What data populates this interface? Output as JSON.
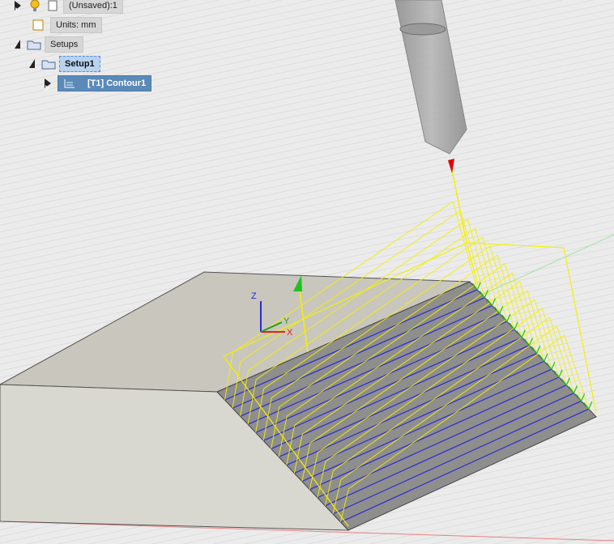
{
  "browser": {
    "document_name": "(Unsaved):1",
    "units_label": "Units: mm",
    "setups_label": "Setups",
    "setup_name": "Setup1",
    "operation_label": "[T1] Contour1"
  },
  "viewcube_axes": {
    "z": "Z",
    "y": "Y",
    "x": "X"
  },
  "colors": {
    "toolpath": "#f5f000",
    "passes": "#2b2bd6",
    "stock_top": "#c9c6be",
    "stock_side": "#d9d8d0",
    "slope": "#8e8e8c",
    "tool": "#9a9a9a",
    "lead_marker": "#e00000",
    "ramp_marker": "#20c020",
    "selection": "#b8d2ef",
    "operation_row": "#5b8ab8"
  }
}
